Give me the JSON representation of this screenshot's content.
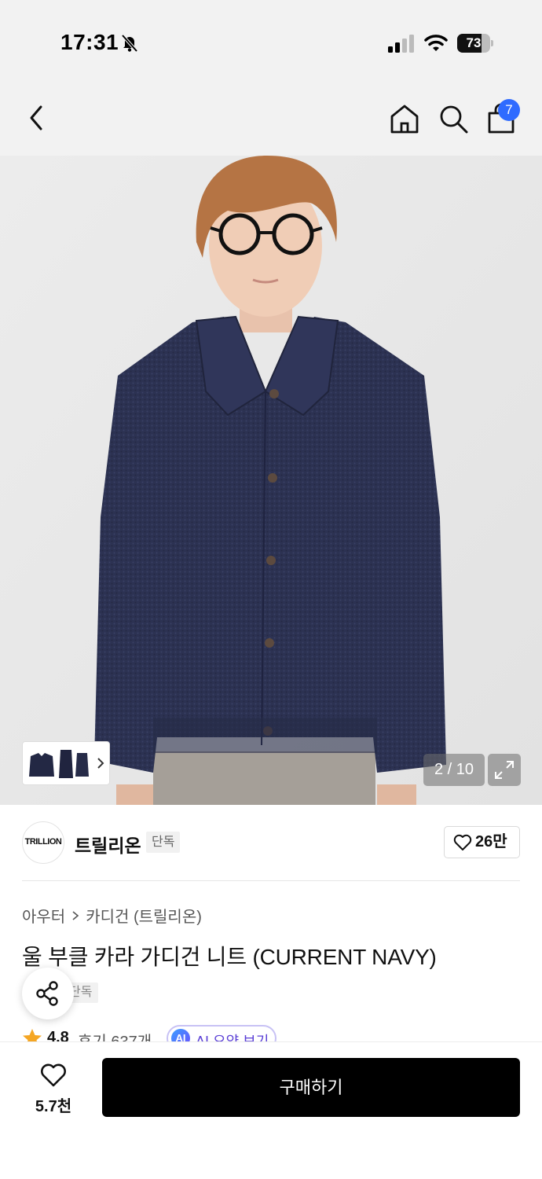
{
  "status_bar": {
    "time": "17:31",
    "battery_percent": 73,
    "battery_label": "73"
  },
  "nav": {
    "cart_count": "7"
  },
  "gallery": {
    "counter": "2 / 10",
    "image_description": "Model wearing a navy boucle collared knit cardigan over grey trousers"
  },
  "brand": {
    "logo_text": "TRILLION",
    "name": "트릴리온",
    "tag": "단독",
    "likes": "26만"
  },
  "product": {
    "breadcrumb": [
      "아우터",
      "카디건 (트릴리온)"
    ],
    "title": "울 부클 카라 가디건 니트 (CURRENT NAVY)",
    "exclusive_tag": "단독",
    "rating": "4.8",
    "reviews": "후기 637개",
    "ai_badge": "AI",
    "ai_summary_label": "AI 요약 보기"
  },
  "bottom_bar": {
    "wish_count": "5.7천",
    "buy_label": "구매하기"
  },
  "colors": {
    "accent_blue": "#2f6bff",
    "star": "#f5a623",
    "ai_purple": "#5a3fd6",
    "buy_button": "#000000"
  }
}
